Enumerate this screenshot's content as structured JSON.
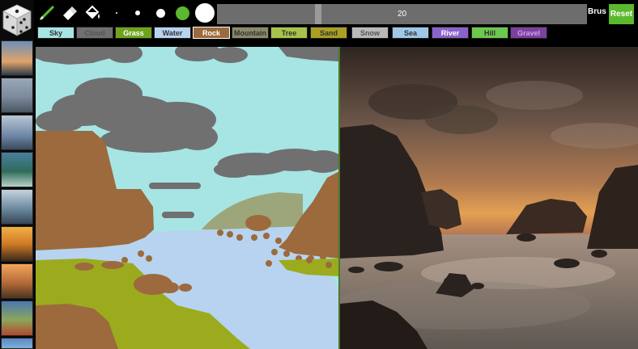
{
  "toolbar": {
    "tools": [
      {
        "name": "brush-icon"
      },
      {
        "name": "eraser-icon"
      },
      {
        "name": "fill-bucket-icon"
      }
    ],
    "brush_sizes": [
      "tiny",
      "small",
      "medium",
      "large",
      "xlarge"
    ],
    "selected_size_color": "#5cb82e",
    "brush_size_value": "20",
    "brush_label": "Brus",
    "reset_label": "Reset"
  },
  "labels": [
    {
      "text": "Sky",
      "bg": "#a7e4e4",
      "fg": "#333333"
    },
    {
      "text": "Cloud",
      "bg": "#707070",
      "fg": "#555555"
    },
    {
      "text": "Grass",
      "bg": "#6fa31e",
      "fg": "#ffffff"
    },
    {
      "text": "Water",
      "bg": "#b7d3f0",
      "fg": "#333333"
    },
    {
      "text": "Rock",
      "bg": "#9c6a3c",
      "fg": "#ffffff"
    },
    {
      "text": "Mountain",
      "bg": "#8a8a6a",
      "fg": "#333333"
    },
    {
      "text": "Tree",
      "bg": "#a9c24a",
      "fg": "#333333"
    },
    {
      "text": "Sand",
      "bg": "#a8a020",
      "fg": "#333333"
    },
    {
      "text": "Snow",
      "bg": "#b9b9b9",
      "fg": "#555555"
    },
    {
      "text": "Sea",
      "bg": "#9ec7e8",
      "fg": "#333333"
    },
    {
      "text": "River",
      "bg": "#8a63c9",
      "fg": "#ffffff"
    },
    {
      "text": "Hill",
      "bg": "#6cc84e",
      "fg": "#333333"
    },
    {
      "text": "Gravel",
      "bg": "#7d3fa0",
      "fg": "#c9a5e0"
    }
  ],
  "thumbnails": [
    "beach-dusk",
    "misty-sea",
    "cloudy-coast",
    "wave-green",
    "lake-trees",
    "sunset-sea",
    "bare-tree-sunset",
    "flowers-field",
    "coast-blue"
  ]
}
